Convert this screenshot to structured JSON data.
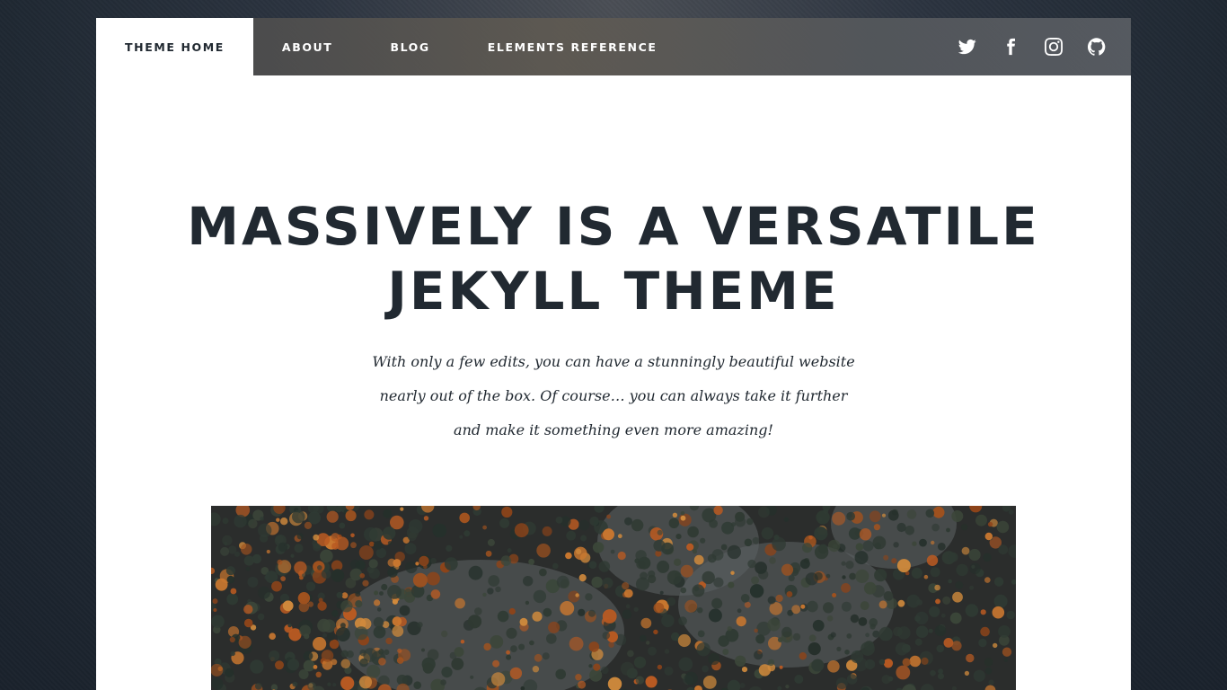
{
  "colors": {
    "accent": "#212931",
    "nav_text": "#ffffff",
    "background": "#1f2832",
    "foliage_orange": "#b85a22",
    "foliage_dark": "#2a2f2c"
  },
  "nav": {
    "links": [
      {
        "label": "Theme Home",
        "active": true
      },
      {
        "label": "About",
        "active": false
      },
      {
        "label": "Blog",
        "active": false
      },
      {
        "label": "Elements Reference",
        "active": false
      }
    ],
    "social_icons": [
      "twitter-icon",
      "facebook-icon",
      "instagram-icon",
      "github-icon"
    ]
  },
  "intro": {
    "title_line1": "Massively is a versatile",
    "title_line2": "Jekyll theme",
    "lead_line1": "With only a few edits, you can have a stunningly beautiful website",
    "lead_line2": "nearly out of the box. Of course… you can always take it further",
    "lead_line3": "and make it something even more amazing!"
  }
}
